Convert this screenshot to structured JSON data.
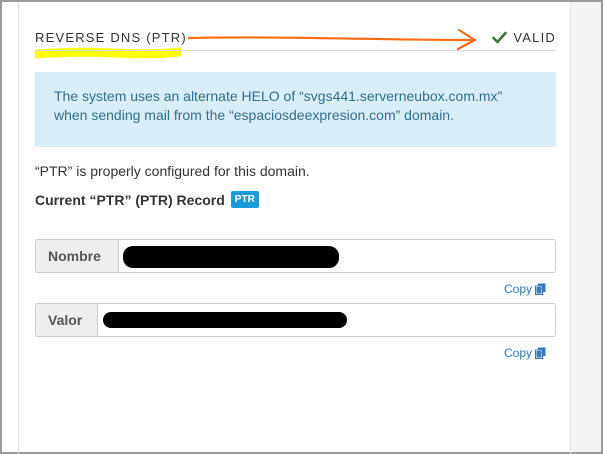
{
  "section": {
    "title": "REVERSE DNS (PTR)",
    "status_label": "VALID",
    "status_icon": "check-icon",
    "status_color": "#3c763d"
  },
  "alert": {
    "line1": "The system uses an alternate HELO of “svgs441.serverneubox.com.mx”",
    "line2": "when sending mail from the “espaciosdeexpresion.com” domain.",
    "background": "#d9edf7",
    "text_color": "#31708f"
  },
  "status_text": "“PTR” is properly configured for this domain.",
  "record": {
    "title": "Current “PTR” (PTR) Record",
    "badge": "PTR",
    "badge_color": "#1a9bd7"
  },
  "fields": [
    {
      "label": "Nombre",
      "value": "",
      "redacted": true,
      "copy_label": "Copy",
      "copy_icon": "copy-icon"
    },
    {
      "label": "Valor",
      "value": "",
      "redacted": true,
      "copy_label": "Copy",
      "copy_icon": "copy-icon"
    }
  ],
  "annotations": {
    "highlight_color": "#ffff00",
    "arrow_color": "#ff6a13"
  }
}
